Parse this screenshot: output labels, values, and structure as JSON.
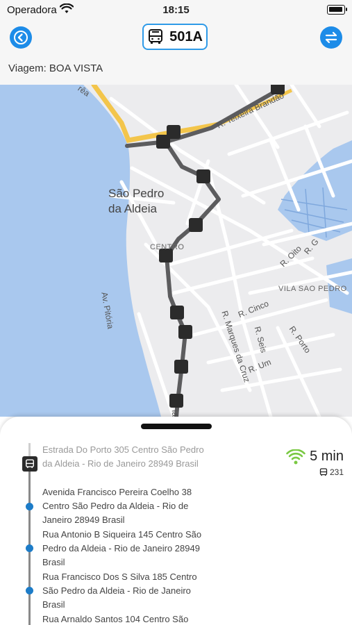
{
  "status_bar": {
    "carrier": "Operadora",
    "time": "18:15"
  },
  "header": {
    "route_number": "501A",
    "trip_label": "Viagem: BOA VISTA"
  },
  "map": {
    "labels": {
      "city": "São Pedro\nda Aldeia",
      "centro": "CENTRO",
      "vila": "VILA SAO PEDRO",
      "teixeira": "R. Teixeira Brandão",
      "marques": "R. Marques da Cruz",
      "pitoria": "Av. Pitória",
      "cinco": "R. Cinco",
      "seis": "R. Seis",
      "um": "R. Um",
      "oito": "R. Oito",
      "g": "R. G",
      "porto": "R. Porto",
      "brea": "rêa",
      "partial": "Ia"
    },
    "colors": {
      "water": "#a9c8ee",
      "land": "#ececee",
      "route": "#5c5c5e",
      "highway": "#f3c54b"
    }
  },
  "sheet": {
    "stops": [
      "Estrada Do Porto 305 Centro São Pedro da Aldeia - Rio de Janeiro 28949 Brasil",
      "Avenida Francisco Pereira Coelho 38 Centro São Pedro da Aldeia - Rio de Janeiro 28949 Brasil",
      "Rua Antonio B Siqueira 145 Centro São Pedro da Aldeia - Rio de Janeiro 28949 Brasil",
      "Rua Francisco Dos S Silva 185 Centro São Pedro da Aldeia - Rio de Janeiro Brasil",
      "Rua Arnaldo Santos 104 Centro São"
    ],
    "eta": {
      "time": "5 min",
      "vehicle": "231",
      "signal_color": "#7ac943"
    },
    "accent": "#1d7cc8"
  }
}
